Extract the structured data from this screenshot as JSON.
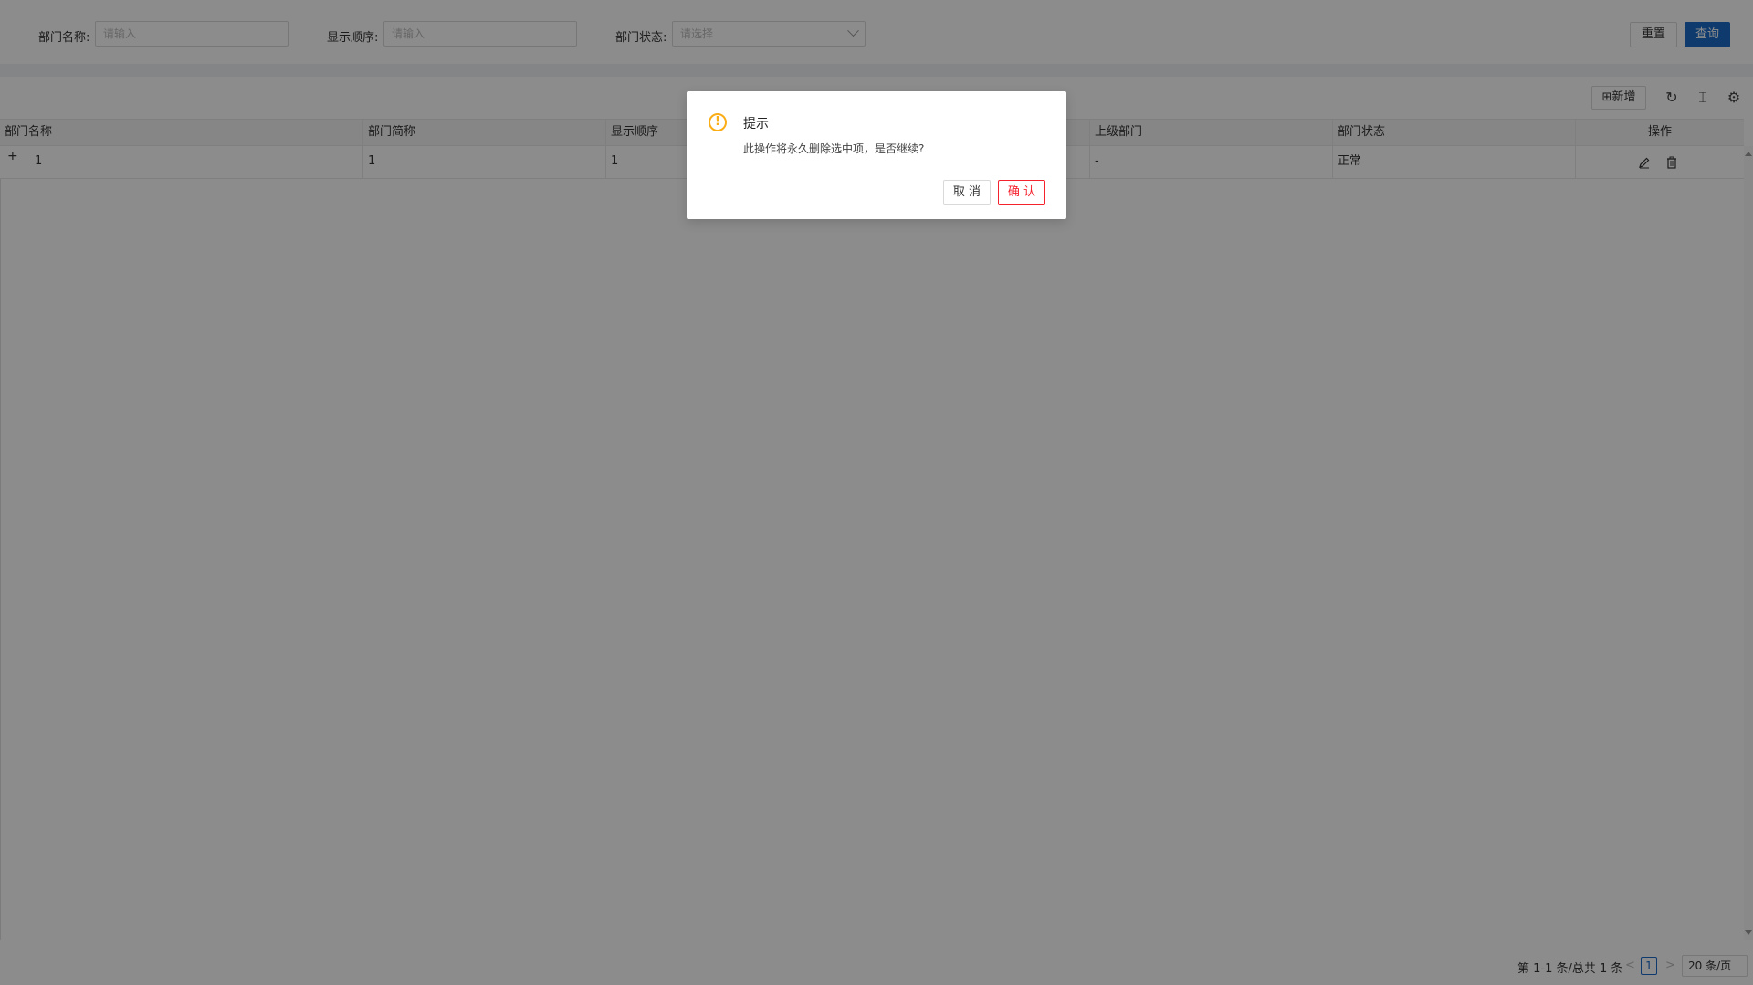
{
  "search": {
    "dept_name_label": "部门名称:",
    "dept_name_placeholder": "请输入",
    "order_label": "显示顺序:",
    "order_placeholder": "请输入",
    "status_label": "部门状态:",
    "status_placeholder": "请选择",
    "reset_label": "重置",
    "query_label": "查询"
  },
  "toolbar": {
    "add_label": "⊞新增",
    "refresh_icon": "refresh-icon",
    "column_icon": "column-height-icon",
    "settings_icon": "gear-icon"
  },
  "table": {
    "columns": [
      "部门名称",
      "部门简称",
      "显示顺序",
      "上级部门",
      "部门状态",
      "操作"
    ],
    "rows": [
      {
        "expand": "+",
        "name": "1",
        "short_name": "1",
        "order": "1",
        "parent": "-",
        "status": "正常"
      }
    ]
  },
  "pager": {
    "total_text": "第 1-1 条/总共 1 条",
    "prev": "<",
    "current_page": "1",
    "next": ">",
    "page_size": "20 条/页"
  },
  "dialog": {
    "title": "提示",
    "content": "此操作将永久删除选中项，是否继续?",
    "cancel_label": "取 消",
    "confirm_label": "确 认",
    "icon": "exclamation-circle-icon"
  },
  "colors": {
    "primary": "#1a6bc8",
    "warning": "#faad14",
    "danger": "#f5222d"
  }
}
